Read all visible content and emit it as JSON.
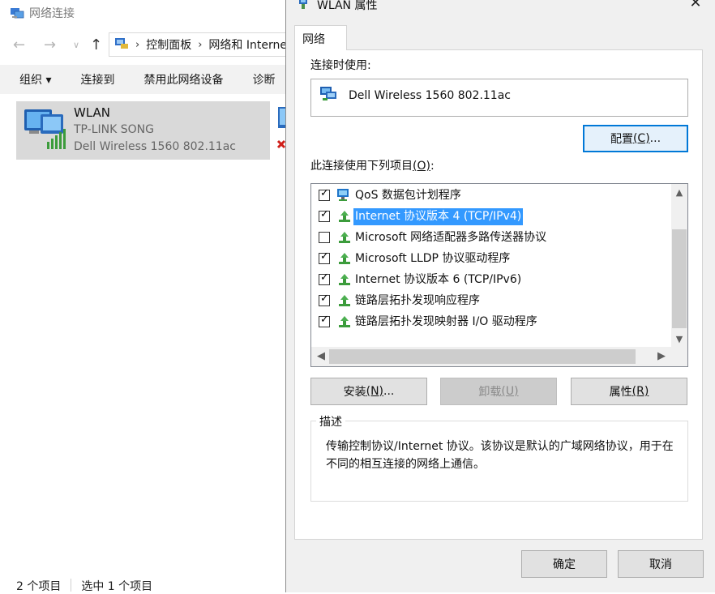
{
  "explorer": {
    "title": "网络连接",
    "address": {
      "crumb1": "控制面板",
      "crumb2": "网络和 Internet"
    },
    "commands": [
      "组织 ▾",
      "连接到",
      "禁用此网络设备",
      "诊断"
    ],
    "adapter": {
      "name": "WLAN",
      "network": "TP-LINK SONG",
      "device": "Dell Wireless 1560 802.11ac"
    },
    "status": {
      "items": "2 个项目",
      "selected": "选中 1 个项目"
    }
  },
  "dialog": {
    "title": "WLAN 属性",
    "tab": "网络",
    "connect_using_label": "连接时使用:",
    "adapter_name": "Dell Wireless 1560 802.11ac",
    "configure_button": {
      "text": "配置",
      "key": "(C)",
      "suffix": "..."
    },
    "items_label": {
      "text": "此连接使用下列项目",
      "key": "(O)",
      "suffix": ":"
    },
    "items": [
      {
        "label": "QoS 数据包计划程序",
        "checked": true,
        "icon": "qos-scheduler-icon",
        "selected": false
      },
      {
        "label": "Internet 协议版本 4 (TCP/IPv4)",
        "checked": true,
        "icon": "protocol-icon",
        "selected": true
      },
      {
        "label": "Microsoft 网络适配器多路传送器协议",
        "checked": false,
        "icon": "protocol-icon",
        "selected": false
      },
      {
        "label": "Microsoft LLDP 协议驱动程序",
        "checked": true,
        "icon": "protocol-icon",
        "selected": false
      },
      {
        "label": "Internet 协议版本 6 (TCP/IPv6)",
        "checked": true,
        "icon": "protocol-icon",
        "selected": false
      },
      {
        "label": "链路层拓扑发现响应程序",
        "checked": true,
        "icon": "protocol-icon",
        "selected": false
      },
      {
        "label": "链路层拓扑发现映射器 I/O 驱动程序",
        "checked": true,
        "icon": "protocol-icon",
        "selected": false
      }
    ],
    "buttons": {
      "install": {
        "text": "安装",
        "key": "(N)",
        "suffix": "..."
      },
      "uninstall": {
        "text": "卸载",
        "key": "(U)",
        "suffix": ""
      },
      "properties": {
        "text": "属性",
        "key": "(R)",
        "suffix": ""
      }
    },
    "description_legend": "描述",
    "description_text": "传输控制协议/Internet 协议。该协议是默认的广域网络协议，用于在不同的相互连接的网络上通信。",
    "ok": "确定",
    "cancel": "取消"
  },
  "colors": {
    "selection": "#3399ff",
    "primary_border": "#0078d7",
    "dialog_bg": "#f0f0f0"
  }
}
